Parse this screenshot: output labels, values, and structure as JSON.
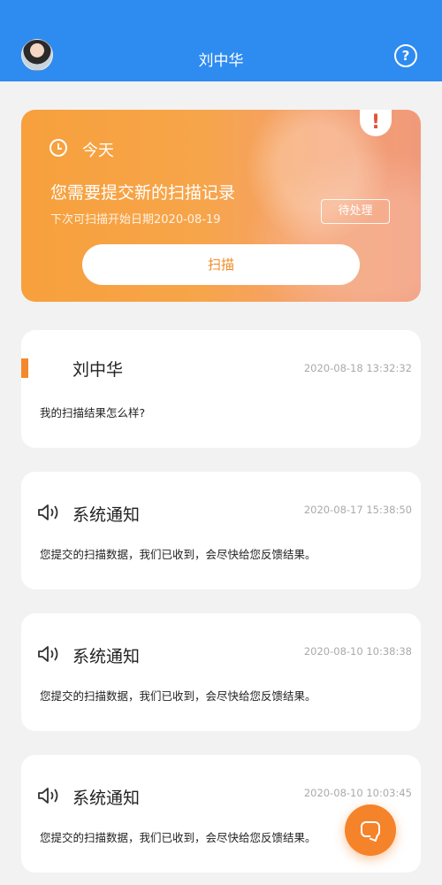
{
  "header": {
    "title": "刘中华",
    "help_icon": "help-icon",
    "help_label": "?"
  },
  "banner": {
    "today": "今天",
    "message": "您需要提交新的扫描记录",
    "next_scan": "下次可扫描开始日期2020-08-19",
    "pending_label": "待处理",
    "alert_label": "!",
    "scan_button": "扫描"
  },
  "messages": [
    {
      "title": "刘中华",
      "time": "2020-08-18 13:32:32",
      "text": "我的扫描结果怎么样?"
    },
    {
      "title": "系统通知",
      "time": "2020-08-17 15:38:50",
      "text": "您提交的扫描数据，我们已收到，会尽快给您反馈结果。"
    },
    {
      "title": "系统通知",
      "time": "2020-08-10 10:38:38",
      "text": "您提交的扫描数据，我们已收到，会尽快给您反馈结果。"
    },
    {
      "title": "系统通知",
      "time": "2020-08-10 10:03:45",
      "text": "您提交的扫描数据，我们已收到，会尽快给您反馈结果。"
    }
  ],
  "colors": {
    "header": "#2e8bf0",
    "accent": "#f5882a"
  }
}
